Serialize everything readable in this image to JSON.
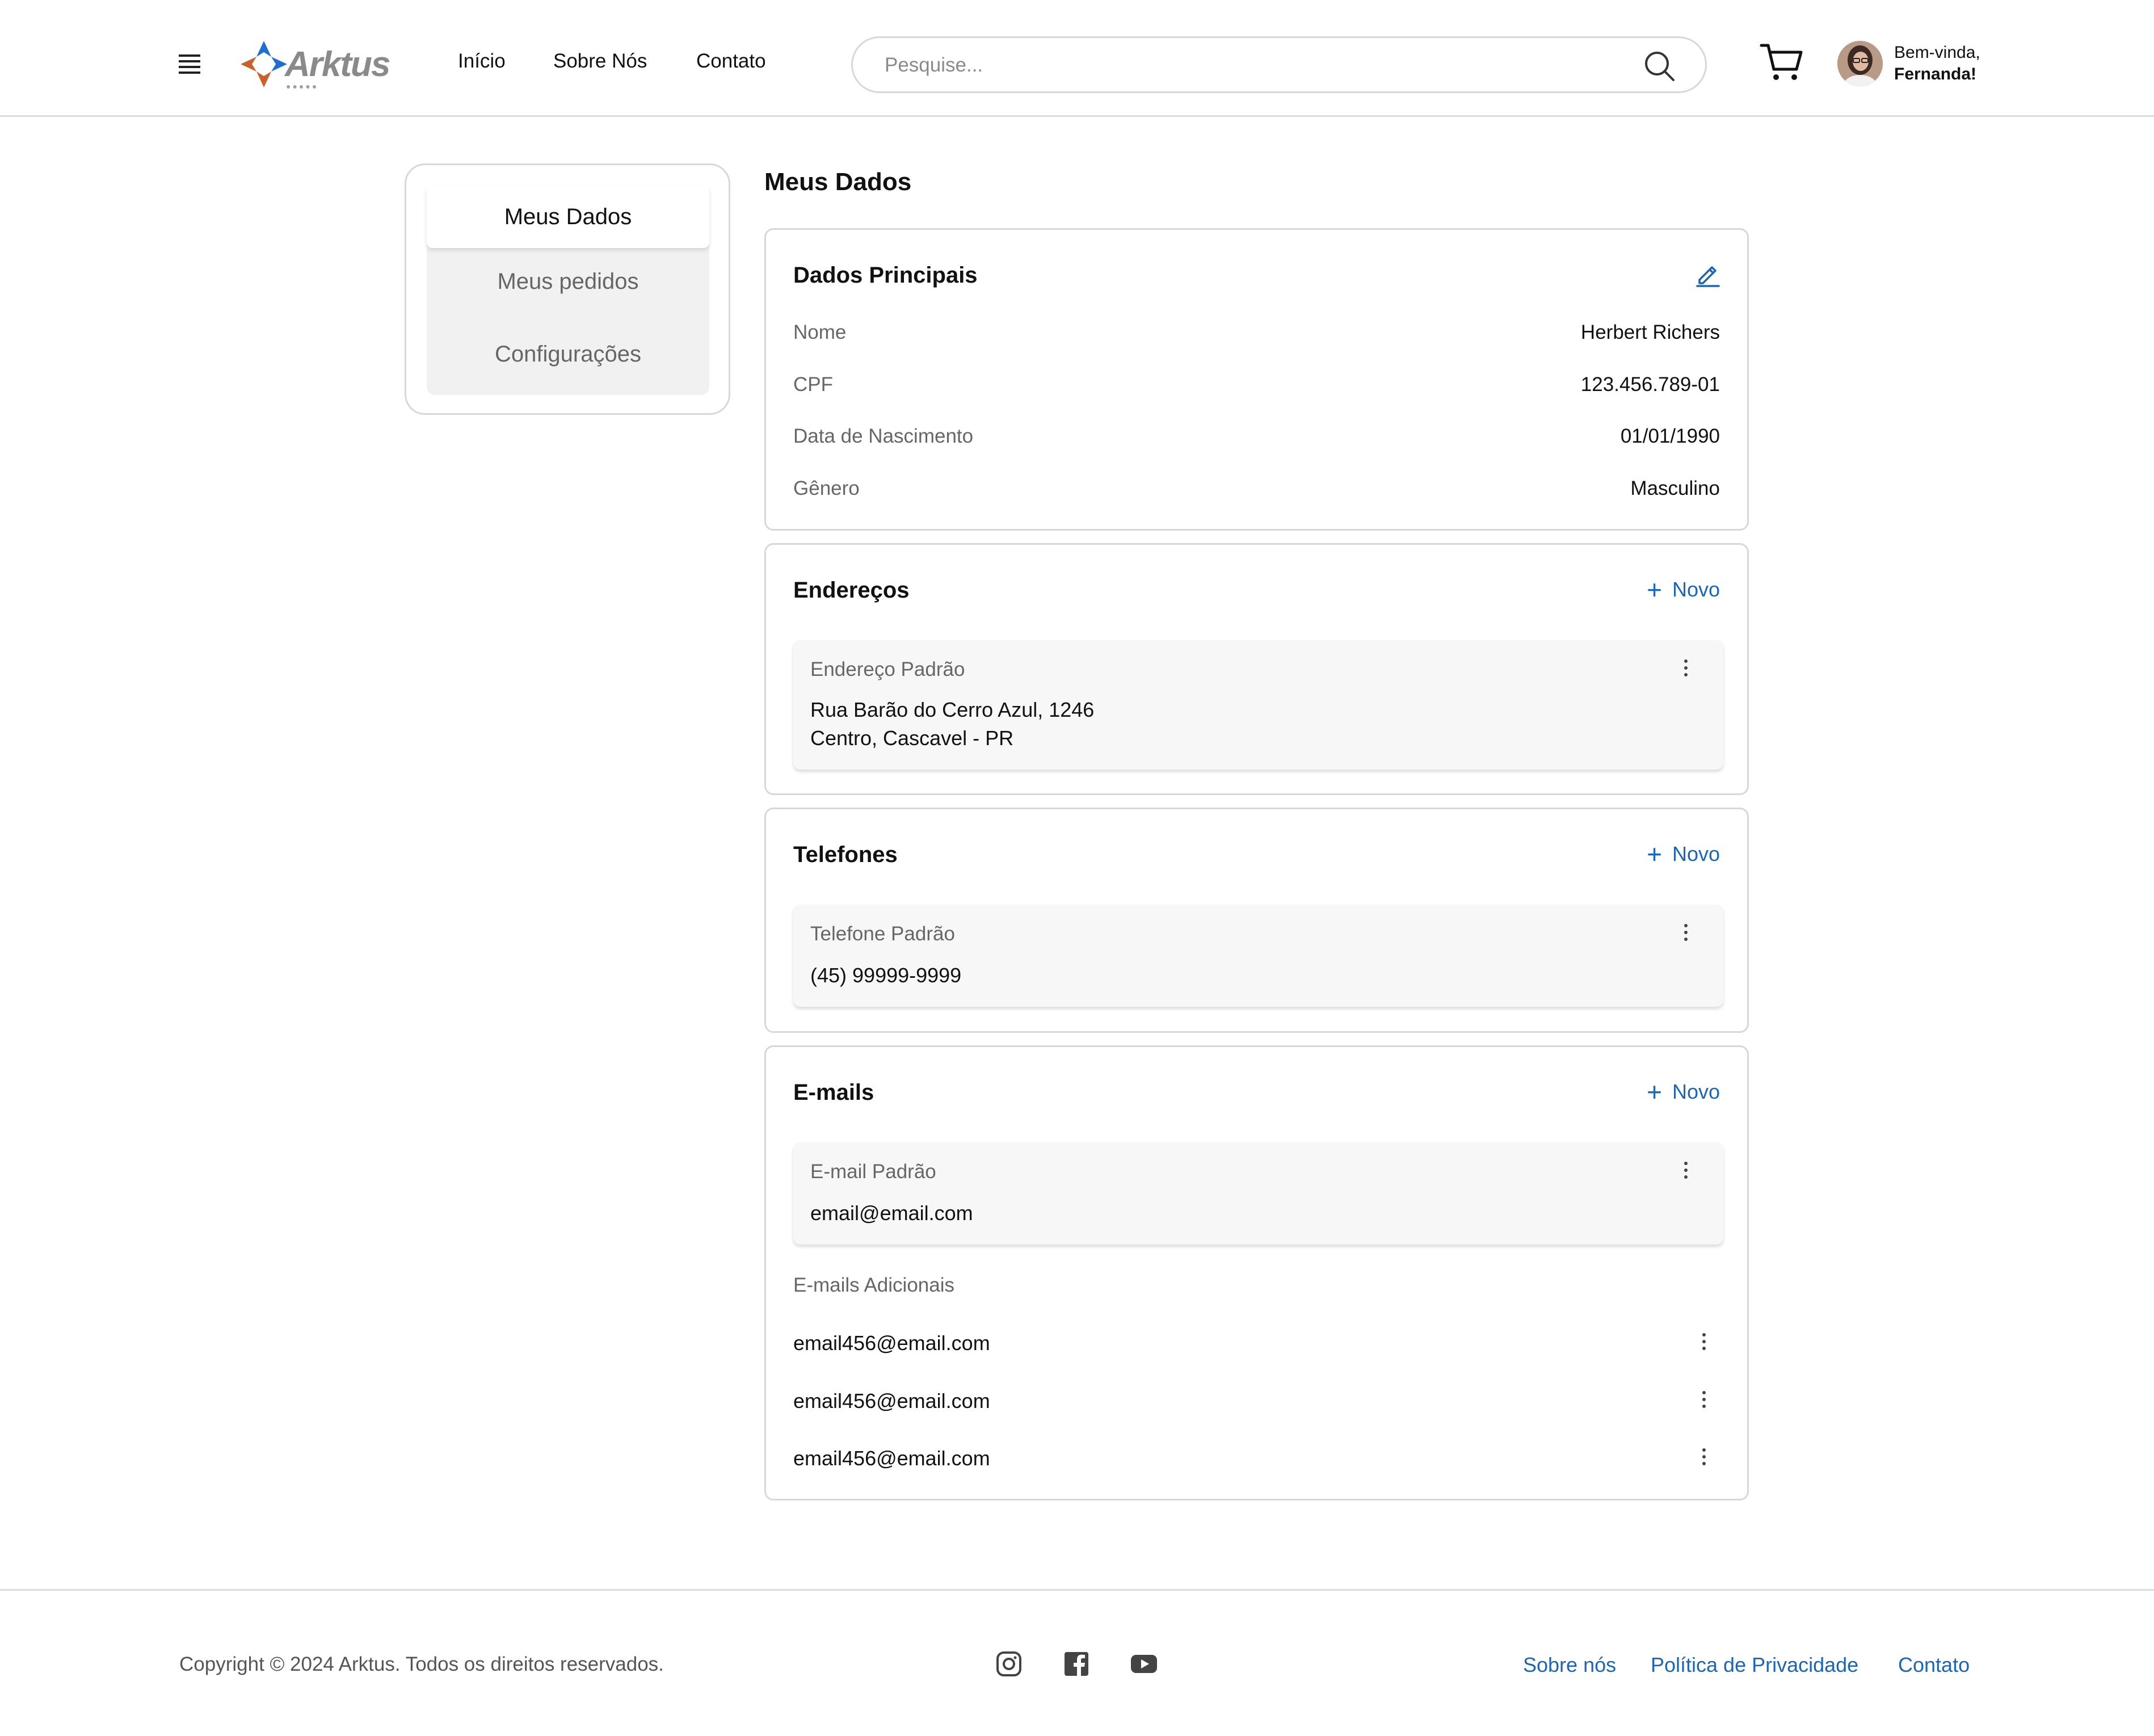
{
  "header": {
    "logo_text": "Arktus",
    "nav": [
      "Início",
      "Sobre Nós",
      "Contato"
    ],
    "search_placeholder": "Pesquise...",
    "greeting_line1": "Bem-vinda,",
    "greeting_line2": "Fernanda!"
  },
  "sidebar": {
    "items": [
      {
        "label": "Meus Dados",
        "active": true
      },
      {
        "label": "Meus pedidos",
        "active": false
      },
      {
        "label": "Configurações",
        "active": false
      }
    ]
  },
  "main": {
    "title": "Meus Dados",
    "dados_principais": {
      "title": "Dados Principais",
      "rows": [
        {
          "label": "Nome",
          "value": "Herbert Richers"
        },
        {
          "label": "CPF",
          "value": "123.456.789-01"
        },
        {
          "label": "Data de Nascimento",
          "value": "01/01/1990"
        },
        {
          "label": "Gênero",
          "value": "Masculino"
        }
      ]
    },
    "enderecos": {
      "title": "Endereços",
      "new_label": "Novo",
      "default_label": "Endereço Padrão",
      "line1": "Rua Barão do Cerro Azul, 1246",
      "line2": "Centro, Cascavel - PR"
    },
    "telefones": {
      "title": "Telefones",
      "new_label": "Novo",
      "default_label": "Telefone Padrão",
      "value": "(45) 99999-9999"
    },
    "emails": {
      "title": "E-mails",
      "new_label": "Novo",
      "default_label": "E-mail Padrão",
      "value": "email@email.com",
      "additional_label": "E-mails Adicionais",
      "additional": [
        "email456@email.com",
        "email456@email.com",
        "email456@email.com"
      ]
    }
  },
  "footer": {
    "copyright": "Copyright © 2024 Arktus. Todos os direitos reservados.",
    "social_icons": [
      "instagram-icon",
      "facebook-icon",
      "youtube-icon"
    ],
    "links": [
      "Sobre nós",
      "Política de Privacidade",
      "Contato"
    ]
  },
  "colors": {
    "accent": "#1a66b8",
    "logo_blue": "#1f6fd0",
    "logo_orange": "#c8622a",
    "border": "#d8d8d8"
  }
}
